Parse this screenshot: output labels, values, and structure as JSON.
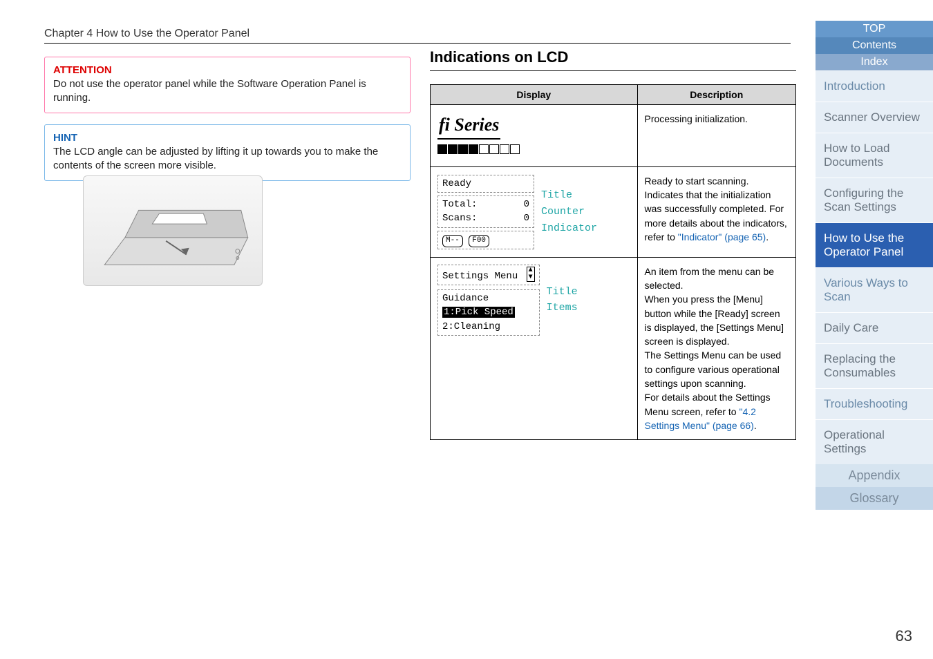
{
  "chapter_header": "Chapter 4 How to Use the Operator Panel",
  "attention": {
    "title": "ATTENTION",
    "body": "Do not use the operator panel while the Software Operation Panel is running."
  },
  "hint": {
    "title": "HINT",
    "body": "The LCD angle can be adjusted by lifting it up towards you to make the contents of the screen more visible."
  },
  "section_title": "Indications on LCD",
  "table": {
    "headers": {
      "display": "Display",
      "description": "Description"
    },
    "rows": [
      {
        "display": {
          "type": "logo",
          "logo_text": "fi Series",
          "progress_filled": 4,
          "progress_total": 8
        },
        "description": "Processing initialization."
      },
      {
        "display": {
          "type": "ready",
          "title_text": "Ready",
          "lines": {
            "total_label": "Total:",
            "total_value": "0",
            "scans_label": "Scans:",
            "scans_value": "0",
            "ind1": "M--",
            "ind2": "F00"
          },
          "annot_title": "Title",
          "annot_counter": "Counter",
          "annot_indicator": "Indicator"
        },
        "description_plain": "Ready to start scanning. Indicates that the initialization was successfully completed. For more details about the indicators, refer to ",
        "description_link": "\"Indicator\" (page 65)",
        "description_after": "."
      },
      {
        "display": {
          "type": "menu",
          "title_text": "Settings Menu",
          "subtitle": "Guidance",
          "item1": "1:Pick Speed",
          "item2": "2:Cleaning",
          "annot_title": "Title",
          "annot_items": "Items"
        },
        "description_plain": "An item from the menu can be selected.\nWhen you press the [Menu] button while the [Ready] screen is displayed, the [Settings Menu] screen is displayed.\nThe Settings Menu can be used to configure various operational settings upon scanning.\nFor details about the Settings Menu screen, refer to ",
        "description_link": "\"4.2 Settings Menu\" (page 66)",
        "description_after": "."
      }
    ]
  },
  "sidebar": {
    "top": "TOP",
    "contents": "Contents",
    "index": "Index",
    "items": [
      "Introduction",
      "Scanner Overview",
      "How to Load Documents",
      "Configuring the Scan Settings",
      "How to Use the Operator Panel",
      "Various Ways to Scan",
      "Daily Care",
      "Replacing the Consumables",
      "Troubleshooting",
      "Operational Settings"
    ],
    "active_index": 4,
    "appendix": "Appendix",
    "glossary": "Glossary"
  },
  "page_number": "63"
}
